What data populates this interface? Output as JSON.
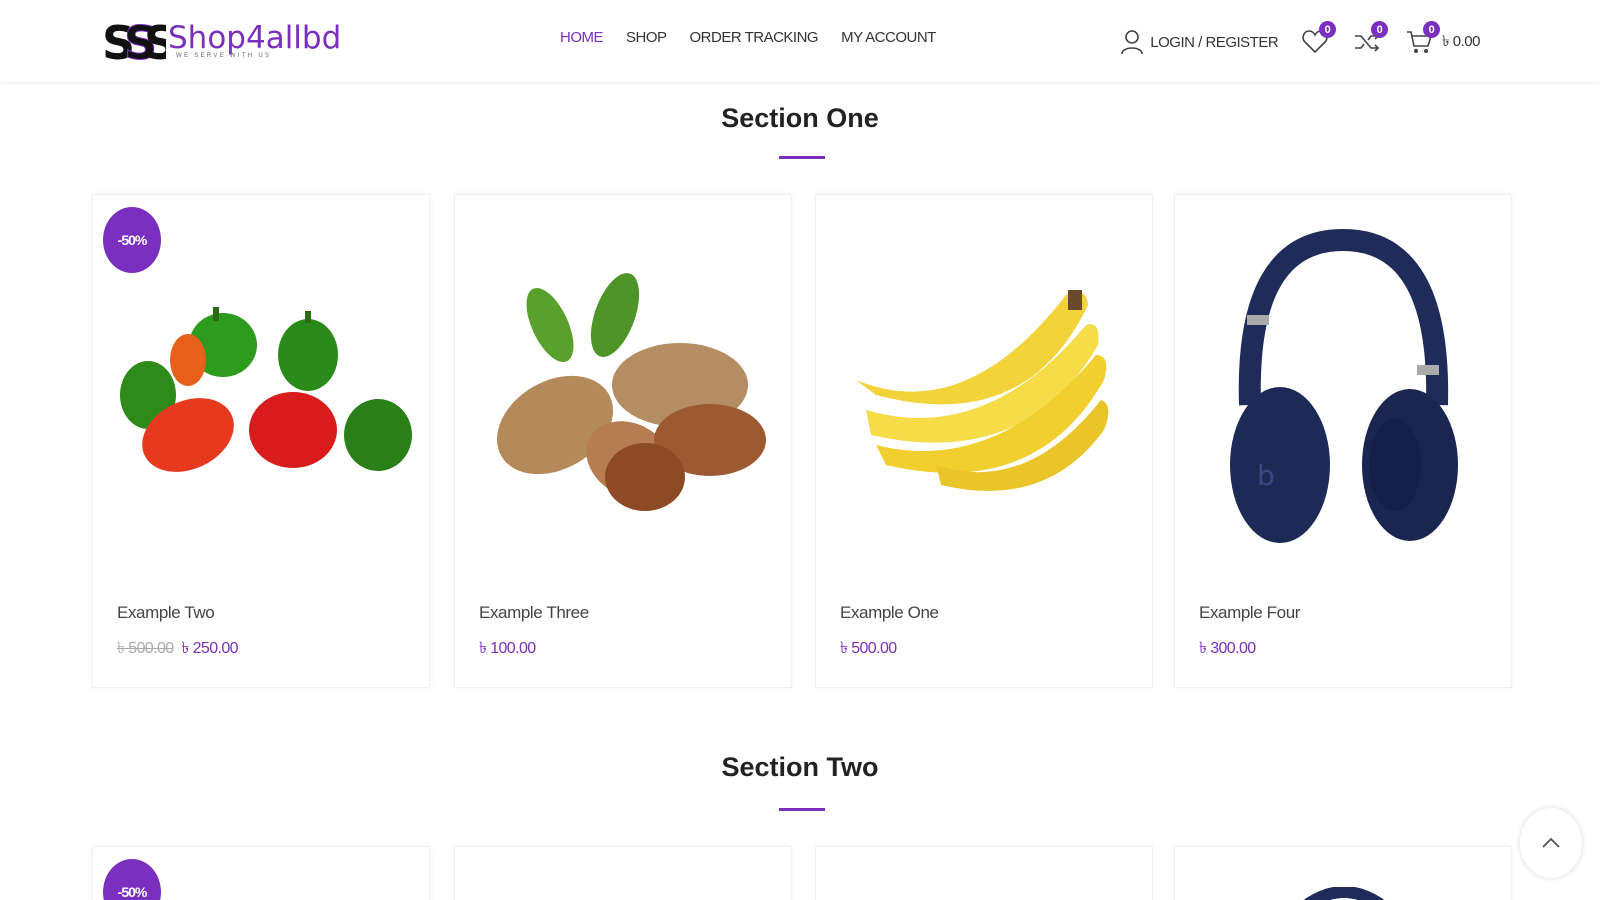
{
  "header": {
    "logo_text": "Shop4allbd",
    "logo_tagline": "WE SERVE WITH US",
    "nav": [
      {
        "label": "HOME",
        "active": true
      },
      {
        "label": "SHOP",
        "active": false
      },
      {
        "label": "ORDER TRACKING",
        "active": false
      },
      {
        "label": "MY ACCOUNT",
        "active": false
      }
    ],
    "login_label": "LOGIN / REGISTER",
    "wishlist_count": "0",
    "compare_count": "0",
    "cart_count": "0",
    "cart_total": "৳ 0.00"
  },
  "colors": {
    "accent": "#7b2fbf"
  },
  "sections": [
    {
      "title": "Section One",
      "products": [
        {
          "name": "Example Two",
          "old_price": "৳ 500.00",
          "price": "৳ 250.00",
          "sale": "-50%",
          "image": "bell-peppers"
        },
        {
          "name": "Example Three",
          "old_price": "",
          "price": "৳ 100.00",
          "sale": "",
          "image": "almonds"
        },
        {
          "name": "Example One",
          "old_price": "",
          "price": "৳ 500.00",
          "sale": "",
          "image": "bananas"
        },
        {
          "name": "Example Four",
          "old_price": "",
          "price": "৳ 300.00",
          "sale": "",
          "image": "headphones"
        }
      ]
    },
    {
      "title": "Section Two",
      "products": [
        {
          "sale": "-50%"
        }
      ]
    }
  ],
  "icons": [
    "user-icon",
    "heart-icon",
    "shuffle-icon",
    "cart-icon",
    "chevron-up-icon"
  ]
}
